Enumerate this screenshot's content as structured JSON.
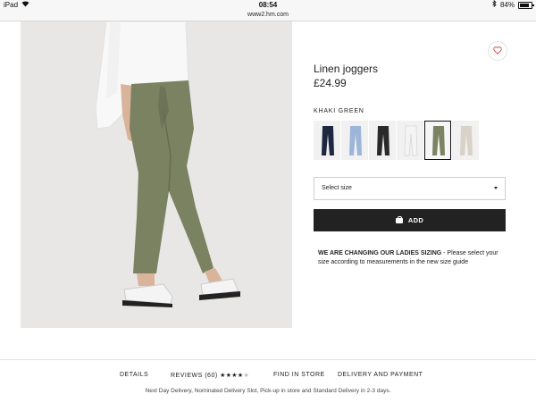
{
  "status_bar": {
    "device": "iPad",
    "time": "08:54",
    "battery": "84%",
    "url": "www2.hm.com"
  },
  "product": {
    "title": "Linen joggers",
    "price": "£24.99",
    "color_label": "KHAKI GREEN",
    "swatches": [
      {
        "color": "#1e2740",
        "name": "dark-blue"
      },
      {
        "color": "#9db5d8",
        "name": "light-blue"
      },
      {
        "color": "#2a2a2c",
        "name": "black"
      },
      {
        "color": "#f4f4f4",
        "name": "white"
      },
      {
        "color": "#7c8264",
        "name": "khaki-green",
        "selected": true
      },
      {
        "color": "#d8d2c8",
        "name": "beige"
      }
    ],
    "size_placeholder": "Select size",
    "add_label": "ADD",
    "sizing_note_bold": "WE ARE CHANGING OUR LADIES SIZING",
    "sizing_note_text": " - Please select your size according to measurements in the new size guide"
  },
  "tabs": {
    "details": "DETAILS",
    "reviews": "REVIEWS (60)",
    "rating": 4,
    "stars_filled": "★★★★",
    "stars_empty": "★",
    "find_in_store": "FIND IN STORE",
    "delivery": "DELIVERY AND PAYMENT"
  },
  "delivery_note": "Next Day Delivery, Nominated Delivery Slot, Pick-up in store and Standard Delivery in 2-3 days."
}
